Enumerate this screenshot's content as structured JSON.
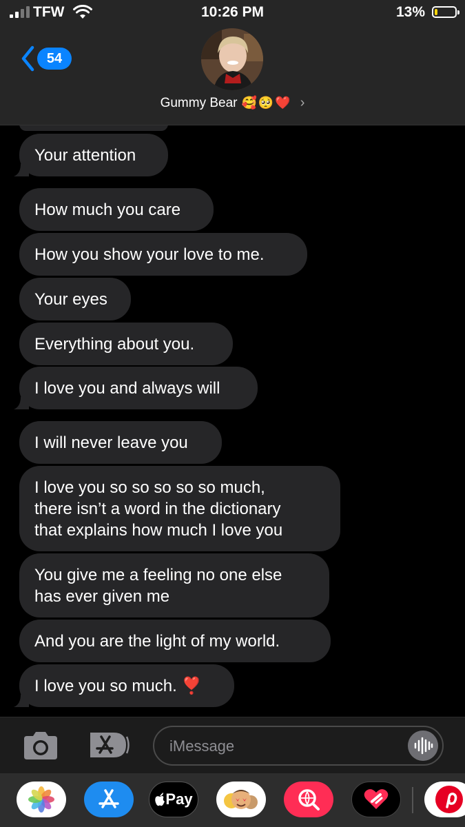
{
  "status_bar": {
    "carrier": "TFW",
    "time": "10:26 PM",
    "battery_percent_label": "13%",
    "battery_level": 0.13
  },
  "header": {
    "back_badge_count": "54",
    "contact_name": "Gummy Bear",
    "contact_emojis": "🥰🥺❤️",
    "chevron": "›"
  },
  "messages": [
    {
      "text": "Your attention"
    },
    {
      "text": "How much you care"
    },
    {
      "text": "How you show your love to me."
    },
    {
      "text": "Your eyes"
    },
    {
      "text": "Everything about you."
    },
    {
      "text": "I love you and always will"
    },
    {
      "text": "I will never leave you"
    },
    {
      "text": "I love you so so so so so much,\nthere isn’t a word in the dictionary\nthat explains how much I love you"
    },
    {
      "text": "You give me a feeling no one else\nhas ever given me"
    },
    {
      "text": "And you are the light of my world."
    },
    {
      "text": "I love you so much. ❣️"
    }
  ],
  "compose": {
    "placeholder": "iMessage"
  },
  "app_drawer": {
    "apple_pay_label": "Pay",
    "apps": [
      "photos-icon",
      "app-store-icon",
      "apple-pay-icon",
      "memoji-icon",
      "images-search-icon",
      "digital-touch-icon",
      "pinterest-icon"
    ]
  },
  "colors": {
    "bubble": "#262628",
    "accent": "#0a84ff",
    "header": "#262626",
    "battery_low": "#ffd60a"
  }
}
